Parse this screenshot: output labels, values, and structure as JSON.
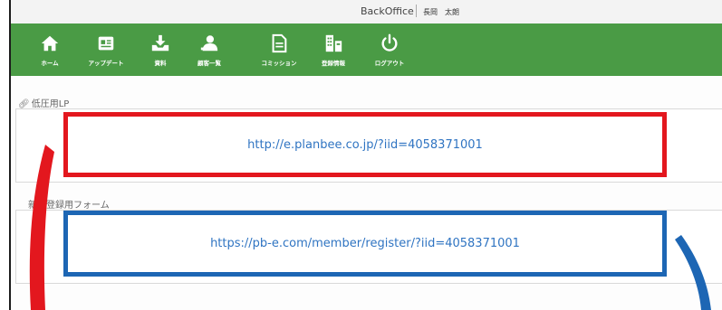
{
  "header": {
    "app_title": "BackOffice",
    "user_name": "長岡　太朗"
  },
  "nav": {
    "items": [
      {
        "label": "ホーム",
        "icon": "home-icon"
      },
      {
        "label": "アップデート",
        "icon": "update-icon"
      },
      {
        "label": "資料",
        "icon": "download-tray-icon"
      },
      {
        "label": "顧客一覧",
        "icon": "customers-icon"
      },
      {
        "label": "コミッション",
        "icon": "document-icon"
      },
      {
        "label": "登録情報",
        "icon": "building-icon"
      },
      {
        "label": "ログアウト",
        "icon": "power-icon"
      }
    ],
    "bg_color": "#4a9b45"
  },
  "sections": {
    "lp": {
      "label": "低圧用LP",
      "url": "http://e.planbee.co.jp/?iid=4058371001",
      "highlight_color": "#e3171e"
    },
    "form": {
      "label": "新規登録用フォーム",
      "url": "https://pb-e.com/member/register/?iid=4058371001",
      "highlight_color": "#1d66b4"
    }
  }
}
